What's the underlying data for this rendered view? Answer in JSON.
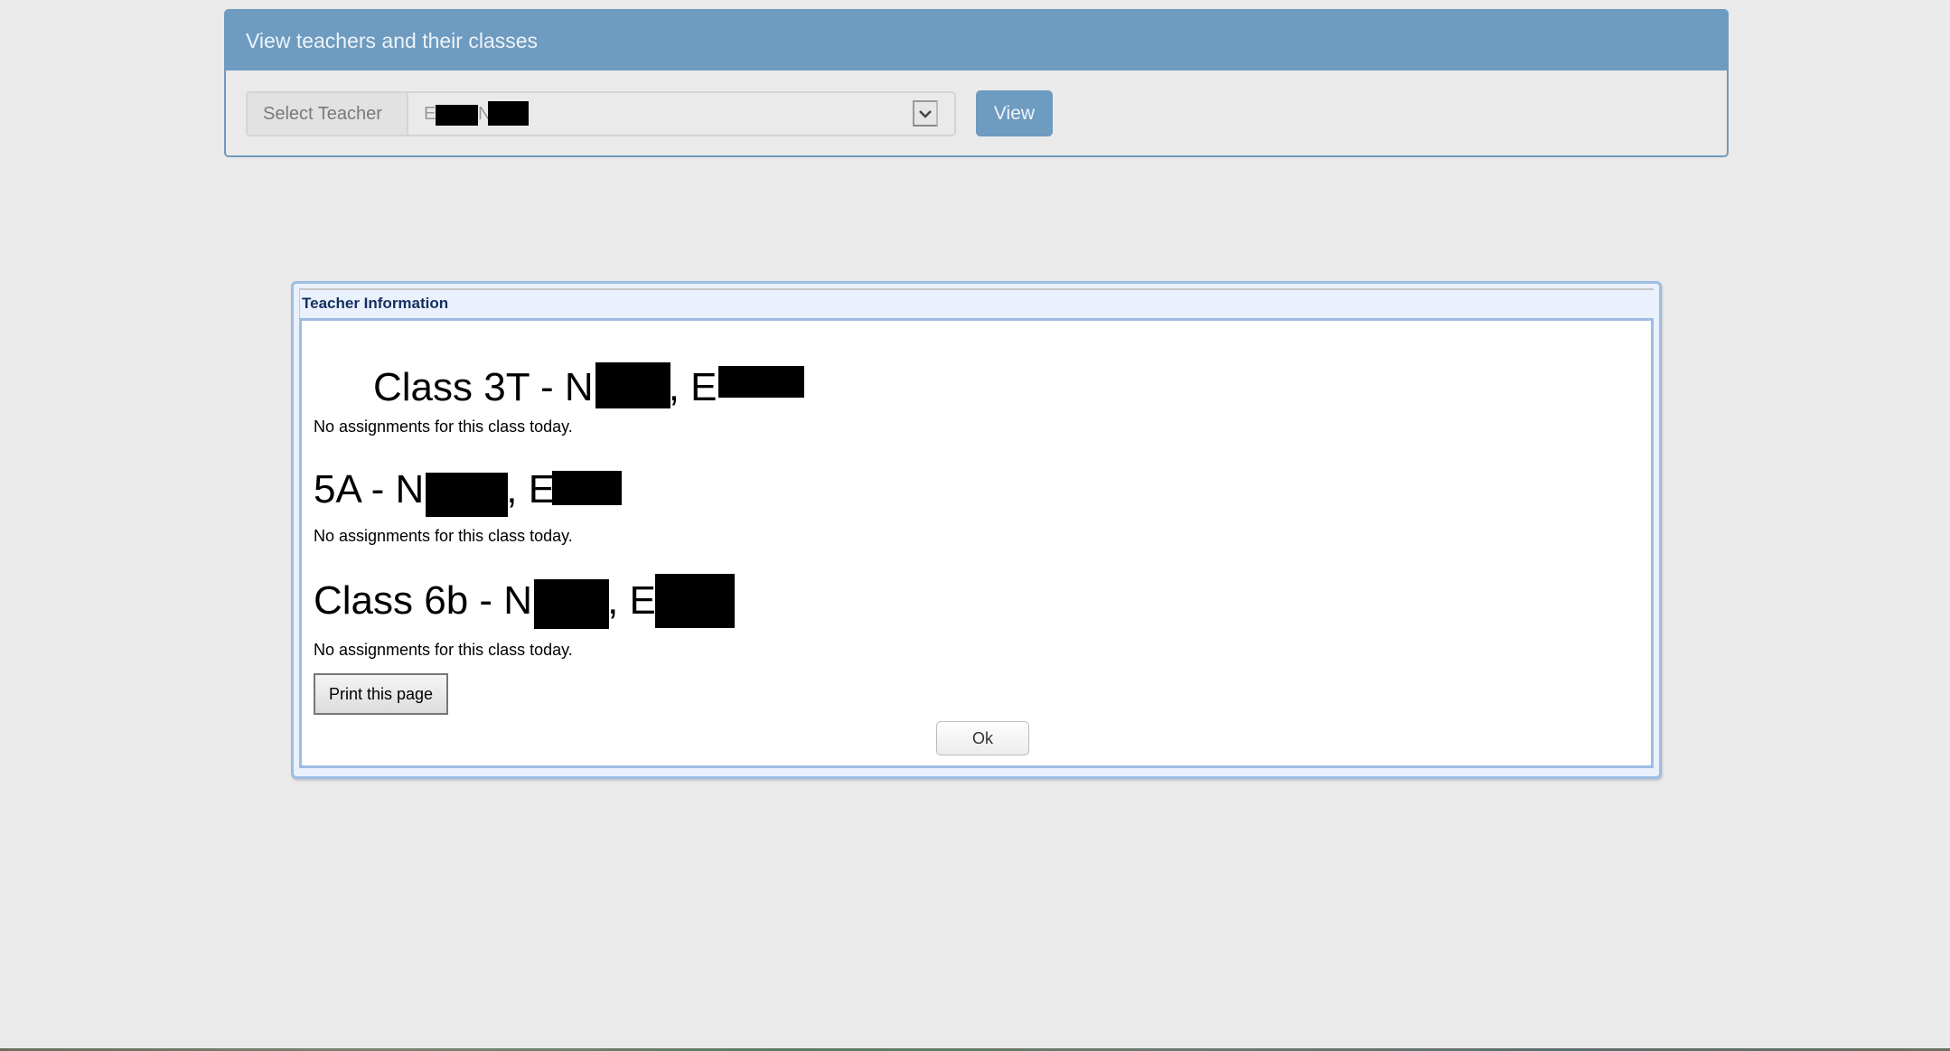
{
  "panel": {
    "title": "View teachers and their classes",
    "select_label": "Select Teacher",
    "selected_teacher_prefix": "E",
    "selected_teacher_mid": "N",
    "arrow_icon": "⌄",
    "view_button": "View",
    "accent_color": "#6e9bc0"
  },
  "dialog": {
    "title": "Teacher Information",
    "classes": [
      {
        "heading_prefix": "Class 3T - N",
        "heading_mid": ", E",
        "note": "No assignments for this class today."
      },
      {
        "heading_prefix": "5A - N",
        "heading_mid": ", E",
        "note": "No assignments for this class today."
      },
      {
        "heading_prefix": "Class 6b - N",
        "heading_mid": ", E",
        "note": "No assignments for this class today."
      }
    ],
    "print_button": "Print this page",
    "ok_button": "Ok"
  }
}
